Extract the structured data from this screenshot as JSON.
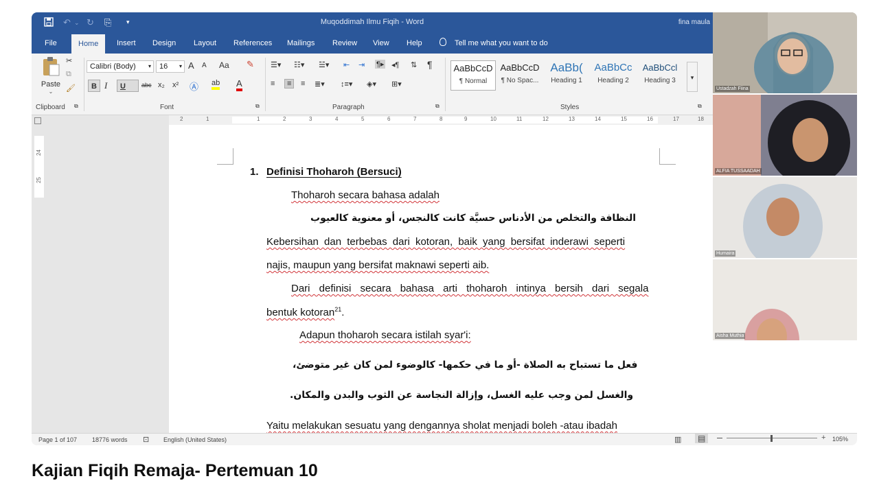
{
  "window": {
    "title": "Muqoddimah Ilmu Fiqih  -  Word",
    "user": "fina maula"
  },
  "tabs": [
    "File",
    "Home",
    "Insert",
    "Design",
    "Layout",
    "References",
    "Mailings",
    "Review",
    "View",
    "Help"
  ],
  "tell_me": "Tell me what you want to do",
  "ribbon": {
    "clipboard": {
      "paste": "Paste",
      "label": "Clipboard"
    },
    "font": {
      "family": "Calibri (Body)",
      "size": "16",
      "label": "Font",
      "grow": "A",
      "shrink": "A",
      "case": "Aa",
      "bold": "B",
      "italic": "I",
      "underline": "U",
      "strike": "abc",
      "sub": "x₂",
      "sup": "x²",
      "color": "A"
    },
    "paragraph": {
      "label": "Paragraph",
      "show_marks": "¶"
    },
    "styles": {
      "label": "Styles",
      "items": [
        {
          "preview": "AaBbCcD",
          "name": "¶ Normal"
        },
        {
          "preview": "AaBbCcD",
          "name": "¶ No Spac..."
        },
        {
          "preview": "AaBb(",
          "name": "Heading 1"
        },
        {
          "preview": "AaBbCc",
          "name": "Heading 2"
        },
        {
          "preview": "AaBbCcl",
          "name": "Heading 3"
        }
      ]
    }
  },
  "ruler": {
    "marks": [
      "2",
      "1",
      "1",
      "2",
      "3",
      "4",
      "5",
      "6",
      "7",
      "8",
      "9",
      "10",
      "11",
      "12",
      "13",
      "14",
      "15",
      "16",
      "17",
      "18"
    ],
    "vertical": [
      "24",
      "25"
    ]
  },
  "document": {
    "heading_num": "1.",
    "heading": "Definisi Thoharoh (Bersuci)",
    "p1": "Thoharoh secara bahasa adalah",
    "arabic1": "النظافة والتخلص من الأدناس حسيَّة كانت كالنجس، أو معنوية كالعيوب",
    "p2a": "Kebersihan dan terbebas dari kotoran, baik yang bersifat inderawi seperti",
    "p2b": "najis, maupun yang bersifat maknawi seperti aib.",
    "p3a": "Dari definisi secara bahasa arti thoharoh intinya bersih dari segala",
    "p3b": "bentuk kotoran",
    "p3b_sup": "21",
    "p3b_end": ".",
    "p4": "Adapun thoharoh secara istilah syar'i:",
    "arabic2": "فعل ما تستباح به الصلاة -أو ما في حكمها- كالوضوء لمن كان غير متوضئ،",
    "arabic3": "والغسل لمن وجب عليه الغسل، وإزالة النجاسة عن الثوب والبدن والمكان.",
    "p5": "Yaitu melakukan sesuatu yang dengannya sholat menjadi boleh -atau ibadah"
  },
  "status": {
    "page": "Page 1 of 107",
    "words": "18776 words",
    "language": "English (United States)",
    "zoom": "105%"
  },
  "participants": [
    "Ustadzah Fiina",
    "ALFIA TUSSAADAH",
    "Humaira",
    "Aisha Muthia"
  ],
  "video_title": "Kajian Fiqih Remaja- Pertemuan 10",
  "colors": {
    "word_blue": "#2b579a",
    "squiggle": "#d13438"
  }
}
